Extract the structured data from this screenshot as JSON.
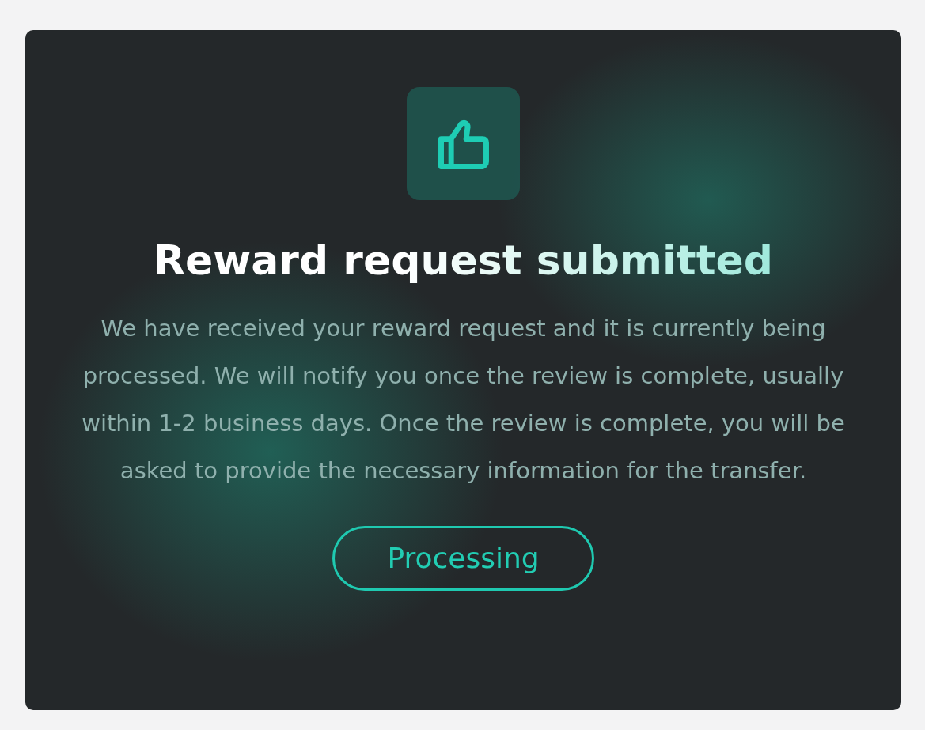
{
  "card": {
    "title": "Reward request submitted",
    "message": "We have received your reward request and it is currently being processed. We will notify you once the review is complete, usually within 1-2 business days. Once the review is complete, you will be asked to provide the necessary information for the transfer.",
    "status": {
      "label": "Processing",
      "kind": "processing"
    }
  }
}
